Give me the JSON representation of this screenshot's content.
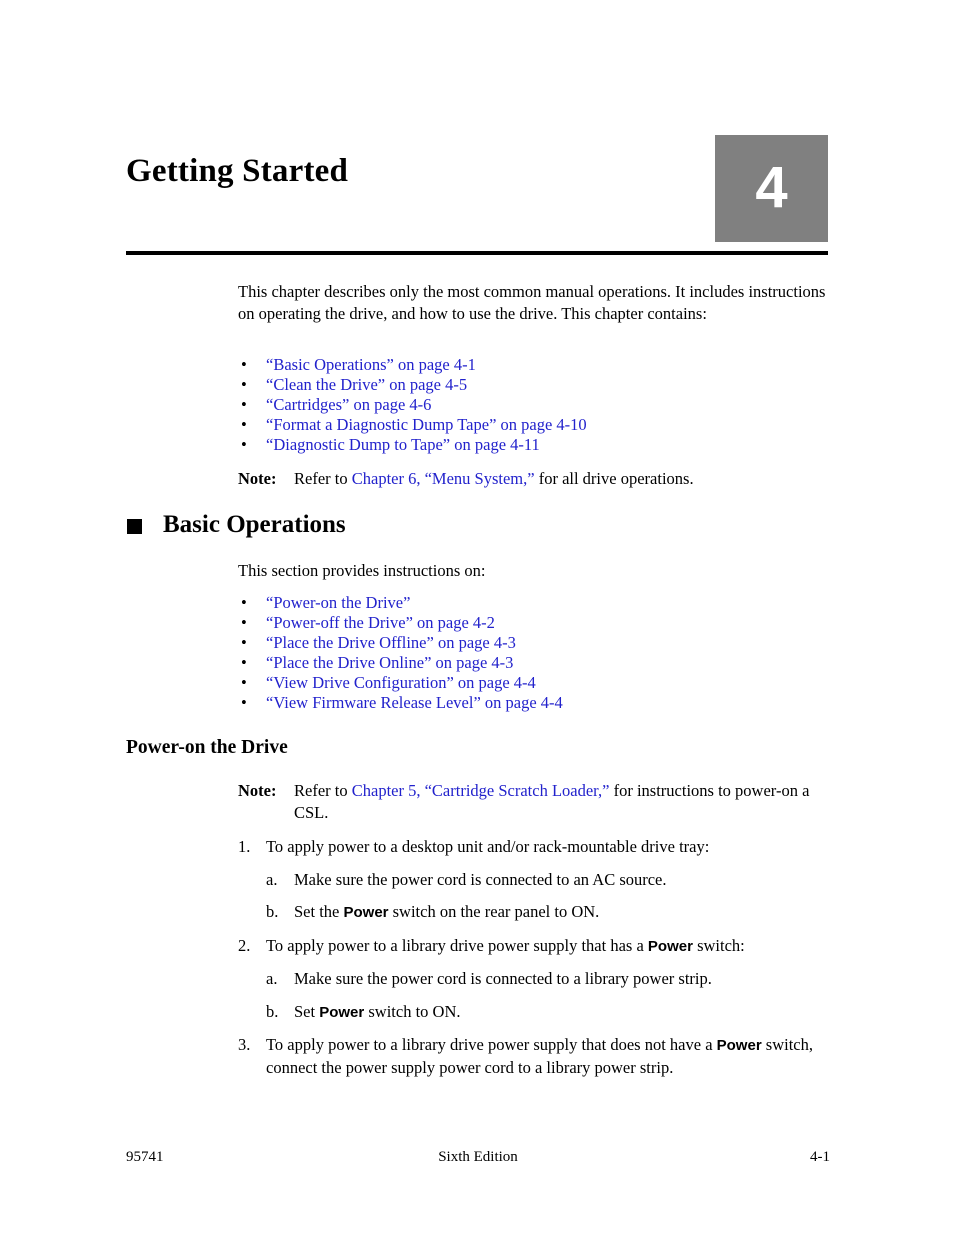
{
  "chapter": {
    "title": "Getting Started",
    "number": "4",
    "number_box_color": "#808080"
  },
  "link_color": "#2222cc",
  "intro": {
    "paragraph": "This chapter describes only the most common manual operations. It includes instructions on operating the drive, and how to use the drive. This chapter contains:",
    "bullet_glyph": "•",
    "bullets": [
      "“Basic Operations” on page 4-1",
      "“Clean the Drive” on page 4-5",
      "“Cartridges” on page 4-6",
      "“Format a Diagnostic Dump Tape” on page 4-10",
      "“Diagnostic Dump to Tape” on page 4-11"
    ],
    "note": {
      "label": "Note:",
      "text_before": "Refer to ",
      "link": "Chapter 6, “Menu System,”",
      "text_after": " for all drive operations."
    }
  },
  "section": {
    "title": "Basic Operations",
    "intro": "This section provides instructions on:",
    "bullets": [
      "“Power-on the Drive”",
      "“Power-off the Drive” on page 4-2",
      "“Place the Drive Offline” on page 4-3",
      "“Place the Drive Online” on page 4-3",
      "“View Drive Configuration” on page 4-4",
      "“View Firmware Release Level” on page 4-4"
    ]
  },
  "subsection": {
    "title": "Power-on the Drive",
    "note": {
      "label": "Note:",
      "text_before": "Refer to ",
      "link": "Chapter 5, “Cartridge Scratch Loader,”",
      "text_after": " for instructions to power-on a CSL."
    },
    "steps": [
      {
        "marker": "1.",
        "text": "To apply power to a desktop unit and/or rack-mountable drive tray:",
        "substeps": [
          {
            "marker": "a.",
            "before": "Make sure the power cord is connected to an AC source.",
            "ui_label": "",
            "after": ""
          },
          {
            "marker": "b.",
            "before": "Set the ",
            "ui_label": "Power",
            "after": " switch on the rear panel to ON."
          }
        ]
      },
      {
        "marker": "2.",
        "before": "To apply power to a library drive power supply that has a ",
        "ui_label": "Power",
        "after": " switch:",
        "substeps": [
          {
            "marker": "a.",
            "before": "Make sure the power cord is connected to a library power strip.",
            "ui_label": "",
            "after": ""
          },
          {
            "marker": "b.",
            "before": "Set ",
            "ui_label": "Power",
            "after": " switch to ON."
          }
        ]
      },
      {
        "marker": "3.",
        "before": "To apply power to a library drive power supply that does not have a ",
        "ui_label": "Power",
        "after": " switch, connect the power supply power cord to a library power strip.",
        "substeps": []
      }
    ]
  },
  "footer": {
    "left": "95741",
    "center": "Sixth Edition",
    "right": "4-1"
  }
}
